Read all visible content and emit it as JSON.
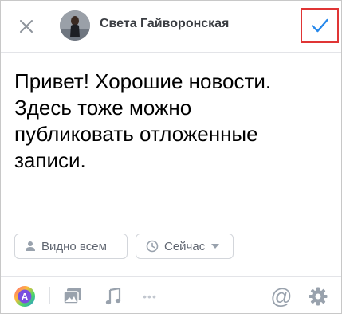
{
  "header": {
    "author_name": "Света Гайворонская"
  },
  "post": {
    "text": "Привет! Хорошие новости.\nЗдесь тоже можно\nпубликовать отложенные\nзаписи."
  },
  "chips": {
    "visibility_label": "Видно всем",
    "time_label": "Сейчас"
  },
  "toolbar": {
    "more_label": "•••",
    "mention_label": "@"
  },
  "colors": {
    "accent": "#2688eb",
    "highlight_border": "#e03535",
    "icon_gray": "#99a2ad"
  },
  "icons": {
    "close": "close-icon",
    "confirm": "checkmark-icon",
    "visibility": "person-icon",
    "time": "clock-icon",
    "background": "color-circle-icon",
    "photo": "photo-icon",
    "music": "music-note-icon",
    "settings": "gear-icon"
  }
}
